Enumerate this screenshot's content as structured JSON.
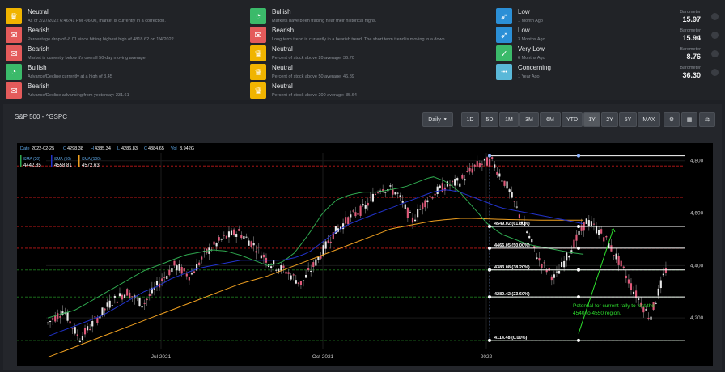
{
  "left_signals": [
    {
      "icon": "medal-icon",
      "color": "#f0b400",
      "title": "Neutral",
      "desc": "As of 2/27/2022 6:46:41 PM -06:00, market is currently in a correction."
    },
    {
      "icon": "chat-icon",
      "color": "#e45b5b",
      "title": "Bearish",
      "desc": "Percentage drop of -8.01 since hitting highest high of 4818.62 on 1/4/2022"
    },
    {
      "icon": "chat-icon",
      "color": "#e45b5b",
      "title": "Bearish",
      "desc": "Market is currently below it's overall 50-day moving average"
    },
    {
      "icon": "gauge-icon",
      "color": "#3bba6a",
      "title": "Bullish",
      "desc": "Advance/Decline currently at a high of 3.45"
    },
    {
      "icon": "chat-icon",
      "color": "#e45b5b",
      "title": "Bearish",
      "desc": "Advance/Decline advancing from yesterday: 231.61"
    }
  ],
  "mid_signals": [
    {
      "icon": "gauge-icon",
      "color": "#3bba6a",
      "title": "Bullish",
      "desc": "Markets have been trading near their historical highs."
    },
    {
      "icon": "chat-icon",
      "color": "#e45b5b",
      "title": "Bearish",
      "desc": "Long term trend is currently in a bearish trend. The short term trend is moving in a down."
    },
    {
      "icon": "medal-icon",
      "color": "#f0b400",
      "title": "Neutral",
      "desc": "Percent of stock above 20 average: 36.70"
    },
    {
      "icon": "medal-icon",
      "color": "#f0b400",
      "title": "Neutral",
      "desc": "Percent of stock above 50 average: 46.89"
    },
    {
      "icon": "medal-icon",
      "color": "#f0b400",
      "title": "Neutral",
      "desc": "Percent of stock above 200 average: 35.64"
    }
  ],
  "barometers": [
    {
      "icon": "rocket-icon",
      "color": "#2b8fd6",
      "title": "Low",
      "period": "1 Month Ago",
      "label": "Barometer",
      "value": "15.97"
    },
    {
      "icon": "rocket-icon",
      "color": "#2b8fd6",
      "title": "Low",
      "period": "3 Months Ago",
      "label": "Barometer",
      "value": "15.94"
    },
    {
      "icon": "thumb-icon",
      "color": "#3bba6a",
      "title": "Very Low",
      "period": "6 Months Ago",
      "label": "Barometer",
      "value": "8.76"
    },
    {
      "icon": "ellipsis-icon",
      "color": "#5ab8d8",
      "title": "Concerning",
      "period": "1 Year Ago",
      "label": "Barometer",
      "value": "36.30"
    }
  ],
  "chart_panel": {
    "title": "S&P 500 - ^GSPC",
    "interval": "Daily",
    "ranges": [
      "1D",
      "5D",
      "1M",
      "3M",
      "6M",
      "YTD",
      "1Y",
      "2Y",
      "5Y",
      "MAX"
    ],
    "selected_range": "1Y"
  },
  "chart_data": {
    "type": "candlestick",
    "header": {
      "date_label": "Date",
      "date": "2022-02-25",
      "o_label": "O",
      "o": "4298.38",
      "h_label": "H",
      "h": "4385.34",
      "l_label": "L",
      "l": "4286.83",
      "c_label": "C",
      "c": "4384.65",
      "vol_label": "Vol",
      "vol": "3.942G"
    },
    "legend": [
      {
        "name": "SMA (20)",
        "value": "4442.85",
        "color": "#2fa84f"
      },
      {
        "name": "SMA (50)",
        "value": "4558.81",
        "color": "#2233cc"
      },
      {
        "name": "SMA (100)",
        "value": "4572.63",
        "color": "#f0a020"
      }
    ],
    "x_ticks": [
      "Jul 2021",
      "Oct 2021",
      "2022"
    ],
    "y_ticks": [
      4200,
      4400,
      4600,
      4800
    ],
    "ylim": [
      4080,
      4830
    ],
    "fib_levels": [
      {
        "label": "4549.02 (61.80%)",
        "value": 4549.02
      },
      {
        "label": "4466.05 (50.00%)",
        "value": 4466.05
      },
      {
        "label": "4383.08 (38.20%)",
        "value": 4383.08
      },
      {
        "label": "4280.42 (23.60%)",
        "value": 4280.42
      },
      {
        "label": "4114.48 (0.00%)",
        "value": 4114.48
      }
    ],
    "fib_top": 4818.62,
    "red_lines": [
      4780,
      4660,
      4549,
      4466
    ],
    "green_lines": [
      4383,
      4280,
      4114
    ],
    "annotation": "Potential for current rally to test the 4540 to 4550 region.",
    "price_path": [
      4180,
      4230,
      4120,
      4190,
      4260,
      4300,
      4250,
      4330,
      4400,
      4360,
      4450,
      4500,
      4530,
      4480,
      4410,
      4380,
      4330,
      4420,
      4520,
      4580,
      4620,
      4700,
      4680,
      4570,
      4660,
      4700,
      4720,
      4780,
      4800,
      4700,
      4560,
      4420,
      4350,
      4460,
      4570,
      4520,
      4420,
      4300,
      4200,
      4384
    ],
    "sma20_path": [
      4200,
      4215,
      4230,
      4260,
      4290,
      4320,
      4350,
      4380,
      4400,
      4420,
      4440,
      4450,
      4460,
      4455,
      4440,
      4420,
      4400,
      4410,
      4450,
      4520,
      4600,
      4650,
      4670,
      4680,
      4680,
      4690,
      4700,
      4720,
      4740,
      4720,
      4680,
      4620,
      4560,
      4520,
      4500,
      4480,
      4470,
      4460,
      4450,
      4443
    ],
    "sma50_path": [
      4130,
      4150,
      4170,
      4190,
      4210,
      4240,
      4270,
      4300,
      4320,
      4350,
      4370,
      4390,
      4400,
      4410,
      4420,
      4420,
      4420,
      4420,
      4430,
      4450,
      4490,
      4530,
      4560,
      4580,
      4600,
      4620,
      4640,
      4660,
      4680,
      4690,
      4680,
      4660,
      4640,
      4620,
      4610,
      4600,
      4590,
      4580,
      4570,
      4559
    ],
    "sma100_path": [
      4050,
      4070,
      4090,
      4110,
      4130,
      4150,
      4170,
      4190,
      4210,
      4230,
      4250,
      4270,
      4290,
      4310,
      4330,
      4345,
      4360,
      4380,
      4400,
      4420,
      4440,
      4460,
      4480,
      4500,
      4520,
      4540,
      4550,
      4560,
      4570,
      4575,
      4580,
      4580,
      4578,
      4576,
      4575,
      4574,
      4573,
      4573,
      4573,
      4573
    ]
  }
}
